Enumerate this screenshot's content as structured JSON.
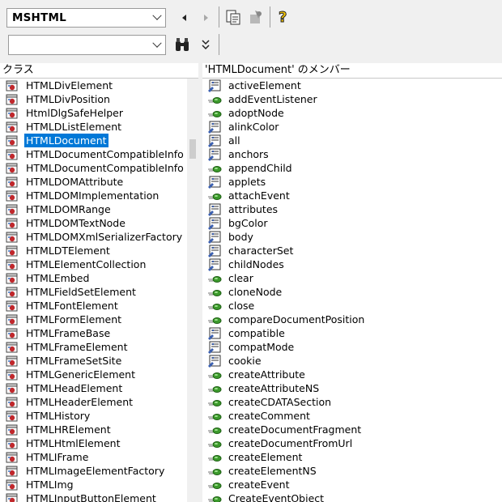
{
  "toolbar": {
    "library_combo": {
      "value": "MSHTML"
    },
    "search_combo": {
      "value": ""
    }
  },
  "classes_pane": {
    "header": "クラス",
    "selected": "HTMLDocument",
    "items": [
      "HTMLDivElement",
      "HTMLDivPosition",
      "HtmlDlgSafeHelper",
      "HTMLDListElement",
      "HTMLDocument",
      "HTMLDocumentCompatibleInfo",
      "HTMLDocumentCompatibleInfo",
      "HTMLDOMAttribute",
      "HTMLDOMImplementation",
      "HTMLDOMRange",
      "HTMLDOMTextNode",
      "HTMLDOMXmlSerializerFactory",
      "HTMLDTElement",
      "HTMLElementCollection",
      "HTMLEmbed",
      "HTMLFieldSetElement",
      "HTMLFontElement",
      "HTMLFormElement",
      "HTMLFrameBase",
      "HTMLFrameElement",
      "HTMLFrameSetSite",
      "HTMLGenericElement",
      "HTMLHeadElement",
      "HTMLHeaderElement",
      "HTMLHistory",
      "HTMLHRElement",
      "HTMLHtmlElement",
      "HTMLIFrame",
      "HTMLImageElementFactory",
      "HTMLImg",
      "HTMLInputButtonElement"
    ]
  },
  "members_pane": {
    "header": "'HTMLDocument' のメンバー",
    "items": [
      {
        "name": "activeElement",
        "kind": "property"
      },
      {
        "name": "addEventListener",
        "kind": "method"
      },
      {
        "name": "adoptNode",
        "kind": "method"
      },
      {
        "name": "alinkColor",
        "kind": "property"
      },
      {
        "name": "all",
        "kind": "property"
      },
      {
        "name": "anchors",
        "kind": "property"
      },
      {
        "name": "appendChild",
        "kind": "method"
      },
      {
        "name": "applets",
        "kind": "property"
      },
      {
        "name": "attachEvent",
        "kind": "method"
      },
      {
        "name": "attributes",
        "kind": "property"
      },
      {
        "name": "bgColor",
        "kind": "property"
      },
      {
        "name": "body",
        "kind": "property"
      },
      {
        "name": "characterSet",
        "kind": "property"
      },
      {
        "name": "childNodes",
        "kind": "property"
      },
      {
        "name": "clear",
        "kind": "method"
      },
      {
        "name": "cloneNode",
        "kind": "method"
      },
      {
        "name": "close",
        "kind": "method"
      },
      {
        "name": "compareDocumentPosition",
        "kind": "method"
      },
      {
        "name": "compatible",
        "kind": "property"
      },
      {
        "name": "compatMode",
        "kind": "property"
      },
      {
        "name": "cookie",
        "kind": "property"
      },
      {
        "name": "createAttribute",
        "kind": "method"
      },
      {
        "name": "createAttributeNS",
        "kind": "method"
      },
      {
        "name": "createCDATASection",
        "kind": "method"
      },
      {
        "name": "createComment",
        "kind": "method"
      },
      {
        "name": "createDocumentFragment",
        "kind": "method"
      },
      {
        "name": "createDocumentFromUrl",
        "kind": "method"
      },
      {
        "name": "createElement",
        "kind": "method"
      },
      {
        "name": "createElementNS",
        "kind": "method"
      },
      {
        "name": "createEvent",
        "kind": "method"
      },
      {
        "name": "CreateEventObject",
        "kind": "method"
      }
    ]
  },
  "icons": {
    "back": "back-arrow-icon",
    "forward": "forward-arrow-icon",
    "copy": "copy-to-clipboard-icon",
    "view_definition": "view-definition-icon",
    "help": "help-icon",
    "search": "binoculars-search-icon",
    "toggle_results": "double-chevron-icon",
    "class": "class-module-icon",
    "property": "property-icon",
    "method": "method-icon"
  },
  "colors": {
    "selection": "#0078d7",
    "method_green": "#3c9a2c",
    "class_red": "#c0282c"
  }
}
